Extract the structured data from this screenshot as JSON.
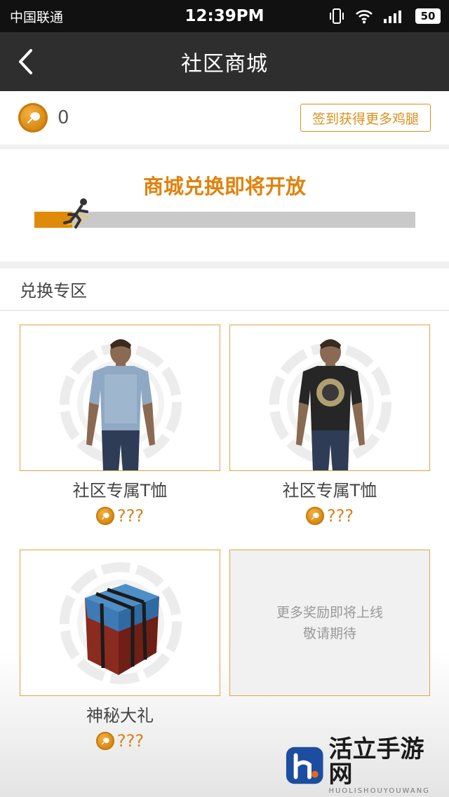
{
  "status_bar": {
    "carrier": "中国联通",
    "time": "12:39PM",
    "battery": "50"
  },
  "header": {
    "title": "社区商城"
  },
  "wallet": {
    "coin_count": "0",
    "checkin_label": "签到获得更多鸡腿"
  },
  "progress": {
    "title": "商城兑换即将开放",
    "value": 0.1
  },
  "section": {
    "title": "兑换专区"
  },
  "items": [
    {
      "name": "社区专属T恤",
      "price": "???"
    },
    {
      "name": "社区专属T恤",
      "price": "???"
    },
    {
      "name": "神秘大礼",
      "price": "???"
    }
  ],
  "coming_soon": {
    "line1": "更多奖励即将上线",
    "line2": "敬请期待"
  },
  "watermark": {
    "title": "活立手游网",
    "subtitle": "HUOLISHOUYOUWANG"
  }
}
